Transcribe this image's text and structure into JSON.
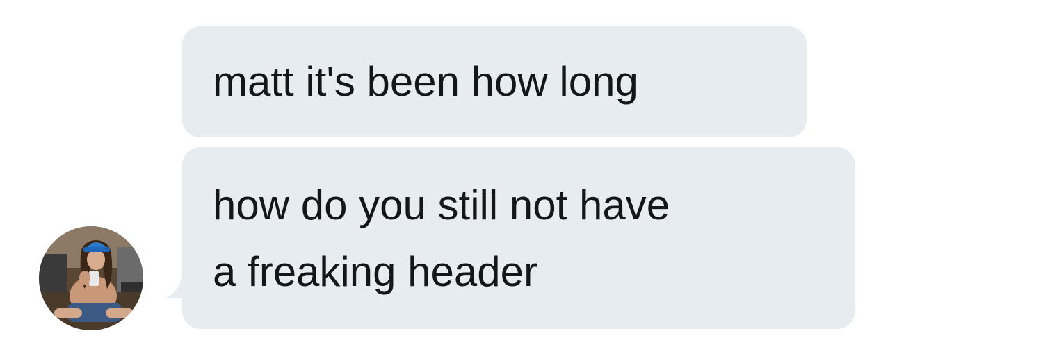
{
  "thread": {
    "messages": [
      {
        "lines": [
          "matt it's been how long"
        ]
      },
      {
        "lines": [
          "how do you still not have",
          "a freaking header"
        ]
      }
    ]
  },
  "colors": {
    "bubble": "#e6ecf0",
    "text": "#14171a",
    "background": "#ffffff"
  },
  "icons": {
    "sender_avatar": "avatar"
  }
}
